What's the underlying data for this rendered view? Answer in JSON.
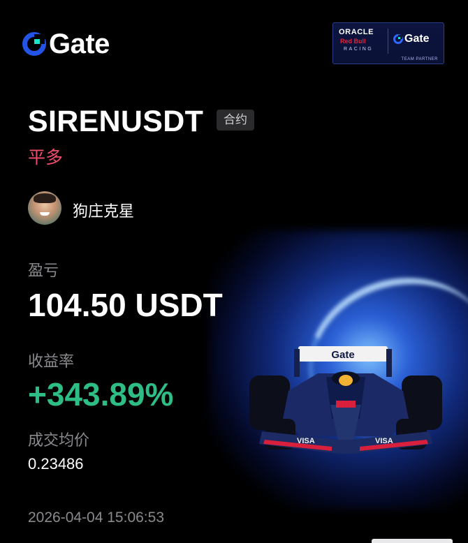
{
  "header": {
    "brand_name": "Gate",
    "partner_badge": {
      "oracle_text": "ORACLE",
      "redbull_text": "Red Bull",
      "racing_text": "RACING",
      "gate_text": "Gate",
      "caption": "TEAM PARTNER"
    }
  },
  "position": {
    "pair": "SIRENUSDT",
    "contract_tag": "合约",
    "direction": "平多",
    "direction_color": "#f04d6a"
  },
  "user": {
    "name": "狗庄克星",
    "avatar": "avatar"
  },
  "stats": {
    "pnl_label": "盈亏",
    "pnl_value": "104.50 USDT",
    "roi_label": "收益率",
    "roi_value": "+343.89%",
    "roi_color": "#2ebd85",
    "avg_price_label": "成交均价",
    "avg_price_value": "0.23486"
  },
  "timestamp": "2026-04-04 15:06:53",
  "illustration": {
    "car_wing_text": "Gate",
    "car_side_text": "VISA"
  },
  "colors": {
    "brand_blue": "#2354e6",
    "background": "#000000"
  }
}
